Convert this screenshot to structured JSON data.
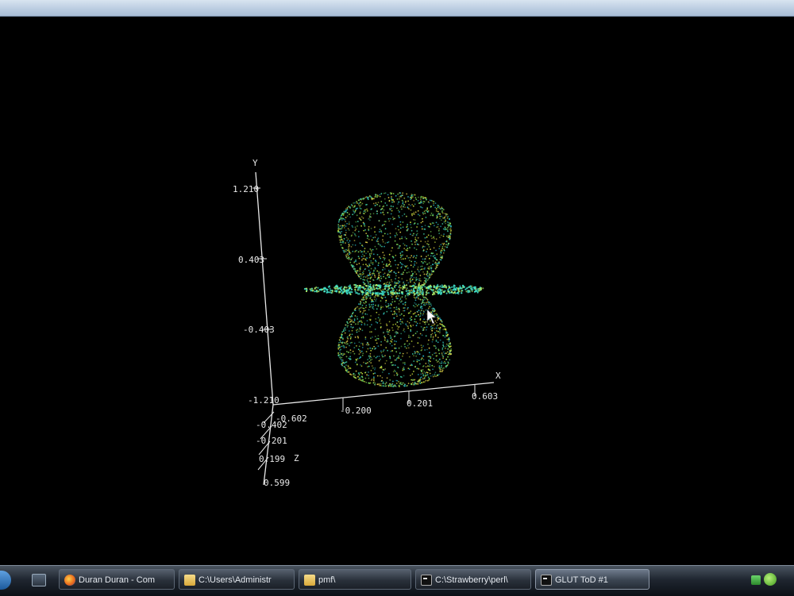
{
  "scene": {
    "axes": {
      "y_axis_label": "Y",
      "x_axis_label": "X",
      "z_axis_label": "Z",
      "y_ticks": [
        "1.210",
        "0.403",
        "-0.403",
        "-1.210"
      ],
      "x_ticks": [
        "-0.200",
        "0.201",
        "0.603"
      ],
      "z_ticks": [
        "-0.602",
        "-0.402",
        "-0.201",
        "0.199",
        "0.599"
      ]
    },
    "point_colors": [
      "#3fd3a6",
      "#7fe05a",
      "#c8e23a",
      "#29b8c9",
      "#e6d64a"
    ],
    "axis_color": "#e8e8e8"
  },
  "taskbar": {
    "buttons": [
      {
        "label": "Duran Duran - Com",
        "icon": "firefox-icon"
      },
      {
        "label": "C:\\Users\\Administr",
        "icon": "folder-icon"
      },
      {
        "label": "pmf\\",
        "icon": "folder-icon"
      },
      {
        "label": "C:\\Strawberry\\perl\\",
        "icon": "cmd-icon"
      },
      {
        "label": "GLUT ToD #1",
        "icon": "cmd-icon",
        "active": true
      }
    ]
  }
}
